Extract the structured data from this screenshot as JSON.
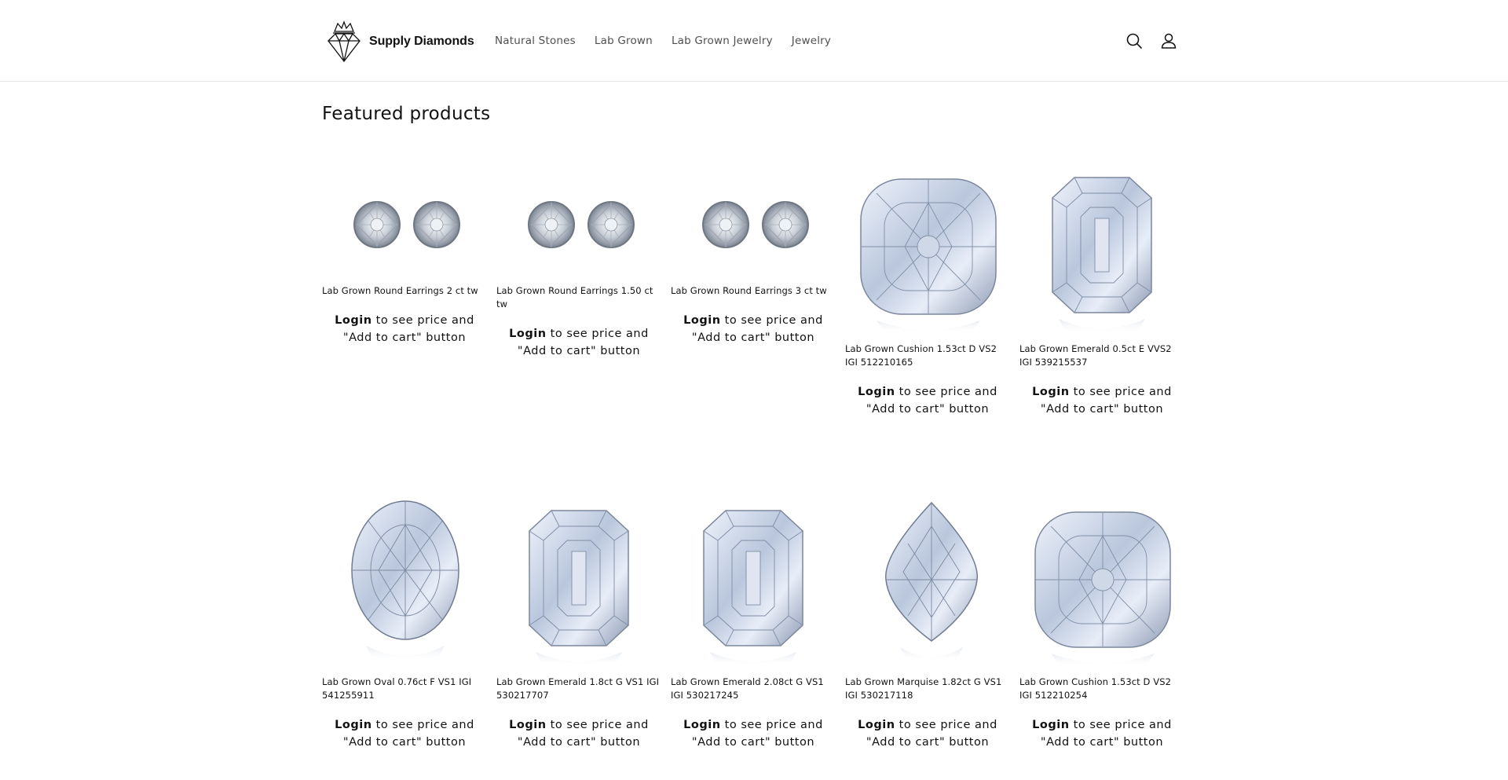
{
  "brand": {
    "name": "Supply Diamonds",
    "logo_icon": "diamond-crown-logo"
  },
  "nav": [
    {
      "label": "Natural Stones"
    },
    {
      "label": "Lab Grown"
    },
    {
      "label": "Lab Grown Jewelry"
    },
    {
      "label": "Jewelry"
    }
  ],
  "header_icons": {
    "search": "search-icon",
    "account": "account-icon"
  },
  "section": {
    "title": "Featured products"
  },
  "cta": {
    "login": "Login",
    "rest_line1": " to see price and",
    "line2": "\"Add to cart\" button"
  },
  "products": [
    {
      "title": "Lab Grown Round Earrings 2 ct tw",
      "image": "round-earrings"
    },
    {
      "title": "Lab Grown Round Earrings 1.50 ct tw",
      "image": "round-earrings"
    },
    {
      "title": "Lab Grown Round Earrings 3 ct tw",
      "image": "round-earrings"
    },
    {
      "title": "Lab Grown Cushion 1.53ct D VS2 IGI 512210165",
      "image": "cushion-diamond"
    },
    {
      "title": "Lab Grown Emerald 0.5ct E VVS2 IGI 539215537",
      "image": "emerald-diamond"
    },
    {
      "title": "Lab Grown Oval 0.76ct F VS1 IGI 541255911",
      "image": "oval-diamond"
    },
    {
      "title": "Lab Grown Emerald 1.8ct G VS1 IGI 530217707",
      "image": "emerald-diamond"
    },
    {
      "title": "Lab Grown Emerald 2.08ct G VS1 IGI 530217245",
      "image": "emerald-diamond"
    },
    {
      "title": "Lab Grown Marquise 1.82ct G VS1 IGI 530217118",
      "image": "marquise-diamond"
    },
    {
      "title": "Lab Grown Cushion 1.53ct D VS2 IGI 512210254",
      "image": "cushion-diamond"
    }
  ]
}
